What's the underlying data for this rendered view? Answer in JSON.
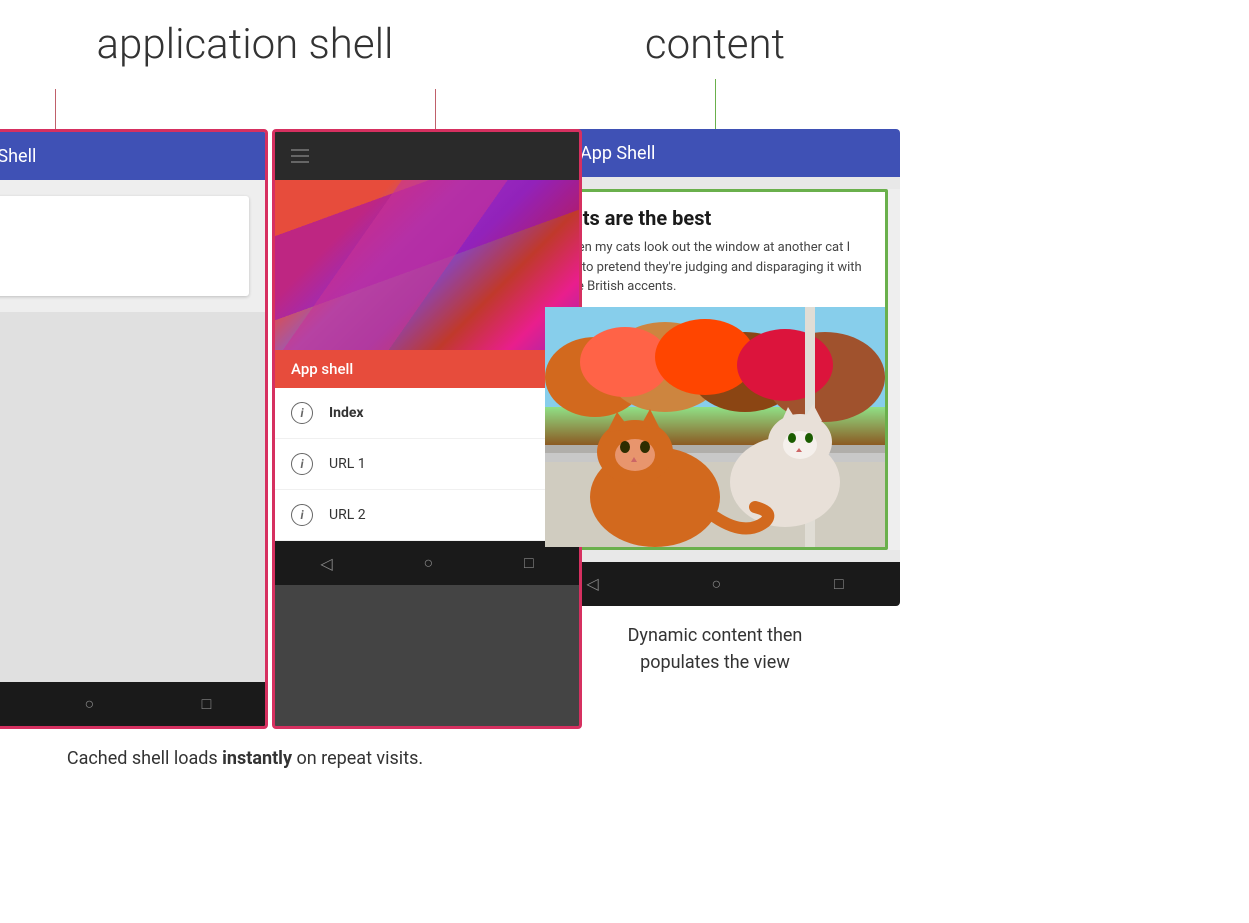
{
  "left": {
    "header": "application shell",
    "appbar_title": "App Shell",
    "caption_prefix": "Cached shell loads ",
    "caption_bold": "instantly",
    "caption_suffix": " on repeat visits."
  },
  "middle": {
    "drawer_label": "App shell",
    "nav_items": [
      {
        "label": "Index",
        "bold": true
      },
      {
        "label": "URL 1",
        "bold": false
      },
      {
        "label": "URL 2",
        "bold": false
      }
    ]
  },
  "right": {
    "header": "content",
    "appbar_title": "App Shell",
    "article_title": "Cats are the best",
    "article_body": "When my cats look out the window at another cat I like to pretend they're judging and disparaging it with little British accents.",
    "caption_line1": "Dynamic content then",
    "caption_line2": "populates the view"
  },
  "nav": {
    "back": "◁",
    "home": "○",
    "recent": "□"
  },
  "colors": {
    "appbar": "#3f51b5",
    "pink_border": "#d63060",
    "green_border": "#6ab04c",
    "green_line": "#6ab04c",
    "pink_line": "#c0606a"
  }
}
